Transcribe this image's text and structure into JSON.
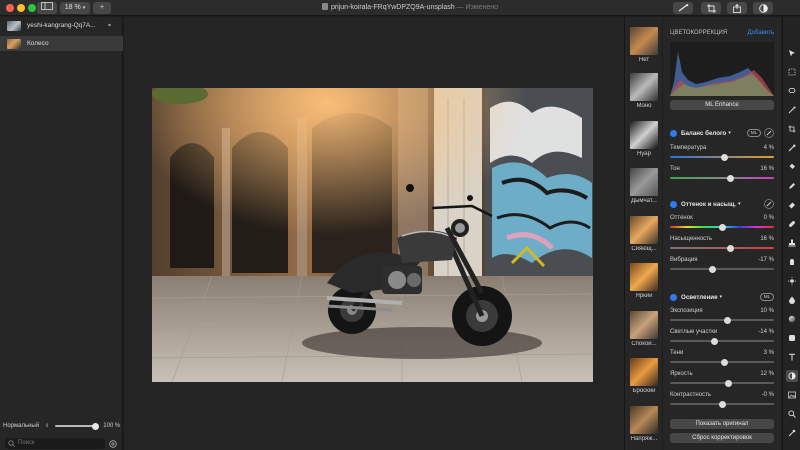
{
  "titlebar": {
    "zoom": "18 %",
    "plus": "+",
    "doc_name": "prijun-koirala-FRqYwDPZQ9A-unsplash",
    "doc_status": " — Изменено"
  },
  "layers": {
    "items": [
      {
        "label": "yeshi-kangrang-Qq7A..."
      },
      {
        "label": "Колесо"
      }
    ]
  },
  "left_footer": {
    "blend_mode": "Нормальный",
    "opacity": "100 %",
    "opacity_fraction": 0.95,
    "search_placeholder": "Поиск"
  },
  "presets": [
    {
      "label": "Нет"
    },
    {
      "label": "Моно"
    },
    {
      "label": "Нуар"
    },
    {
      "label": "Дымчат..."
    },
    {
      "label": "Сияющ..."
    },
    {
      "label": "Яркий"
    },
    {
      "label": "Спокой..."
    },
    {
      "label": "Броский"
    },
    {
      "label": "Напряж..."
    }
  ],
  "color_correction": {
    "title": "ЦВЕТОКОРРЕКЦИЯ",
    "add_button": "Добавить",
    "ml_enhance": "ML Enhance"
  },
  "white_balance": {
    "title": "Баланс белого",
    "params": [
      {
        "label": "Температура",
        "value": "4 %",
        "position": 0.52
      },
      {
        "label": "Тон",
        "value": "16 %",
        "position": 0.58
      }
    ]
  },
  "hue_saturation": {
    "title": "Оттенок и насыщ.",
    "params": [
      {
        "label": "Оттенок",
        "value": "0 %",
        "position": 0.5
      },
      {
        "label": "Насыщенность",
        "value": "16 %",
        "position": 0.58
      },
      {
        "label": "Вибрация",
        "value": "-17 %",
        "position": 0.41
      }
    ]
  },
  "lighten": {
    "title": "Осветление",
    "params": [
      {
        "label": "Экспозиция",
        "value": "10 %",
        "position": 0.55
      },
      {
        "label": "Светлые участки",
        "value": "-14 %",
        "position": 0.43
      },
      {
        "label": "Тени",
        "value": "3 %",
        "position": 0.52
      },
      {
        "label": "Яркость",
        "value": "12 %",
        "position": 0.56
      },
      {
        "label": "Контрастность",
        "value": "-0 %",
        "position": 0.5
      }
    ]
  },
  "buttons": {
    "show_original": "Показать оригинал",
    "reset": "Сброс корректировок"
  },
  "badges": {
    "ml": "ML"
  },
  "colors": {
    "accent": "#2f7bf5",
    "background": "#1e1e1e",
    "panel": "#262626"
  }
}
